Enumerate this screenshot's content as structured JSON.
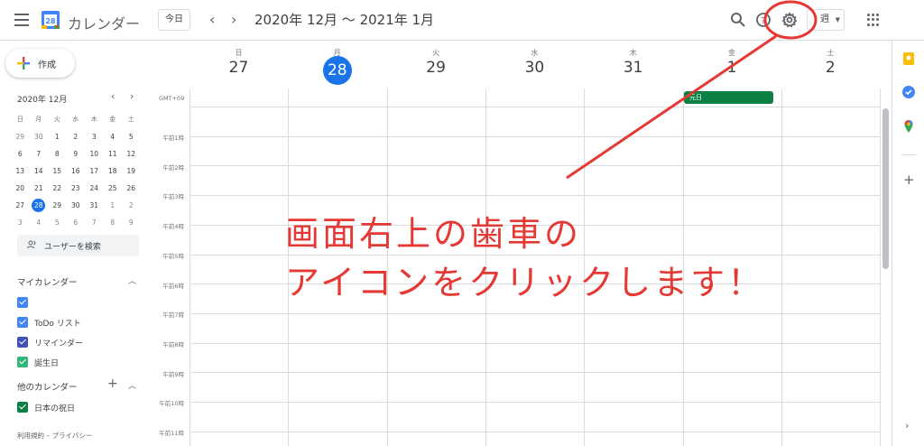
{
  "header": {
    "app_title": "カレンダー",
    "logo_day": "28",
    "today_label": "今日",
    "prev_icon": "chevron-left-icon",
    "next_icon": "chevron-right-icon",
    "range_title": "2020年 12月 ～ 2021年 1月",
    "view_label": "週",
    "brand_colors": {
      "blue": "#4285f4",
      "red": "#ea4335",
      "yellow": "#fbbc04",
      "green": "#34a853"
    }
  },
  "sidebar": {
    "create_label": "作成",
    "mini_calendar": {
      "title": "2020年 12月",
      "weekdays": [
        "日",
        "月",
        "火",
        "水",
        "木",
        "金",
        "土"
      ],
      "weeks": [
        [
          "29",
          "30",
          "1",
          "2",
          "3",
          "4",
          "5"
        ],
        [
          "6",
          "7",
          "8",
          "9",
          "10",
          "11",
          "12"
        ],
        [
          "13",
          "14",
          "15",
          "16",
          "17",
          "18",
          "19"
        ],
        [
          "20",
          "21",
          "22",
          "23",
          "24",
          "25",
          "26"
        ],
        [
          "27",
          "28",
          "29",
          "30",
          "31",
          "1",
          "2"
        ],
        [
          "3",
          "4",
          "5",
          "6",
          "7",
          "8",
          "9"
        ]
      ],
      "selected": "28"
    },
    "search_people_label": "ユーザーを検索",
    "my_calendars_title": "マイカレンダー",
    "my_calendars": [
      {
        "label": "",
        "color": "#4285f4"
      },
      {
        "label": "ToDo リスト",
        "color": "#4285f4"
      },
      {
        "label": "リマインダー",
        "color": "#3f51b5"
      },
      {
        "label": "誕生日",
        "color": "#33b679"
      }
    ],
    "other_calendars_title": "他のカレンダー",
    "other_calendars": [
      {
        "label": "日本の祝日",
        "color": "#0b8043"
      }
    ],
    "footer": "利用規約 – プライバシー"
  },
  "week": {
    "days": [
      {
        "name": "日",
        "num": "27",
        "today": false
      },
      {
        "name": "月",
        "num": "28",
        "today": true
      },
      {
        "name": "火",
        "num": "29",
        "today": false
      },
      {
        "name": "水",
        "num": "30",
        "today": false
      },
      {
        "name": "木",
        "num": "31",
        "today": false
      },
      {
        "name": "金",
        "num": "1",
        "today": false
      },
      {
        "name": "土",
        "num": "2",
        "today": false
      }
    ],
    "timezone": "GMT+09",
    "allday_event": {
      "label": "元日",
      "day": "金",
      "color": "#0b8043"
    },
    "hours": [
      "午前1時",
      "午前2時",
      "午前3時",
      "午前4時",
      "午前5時",
      "午前6時",
      "午前7時",
      "午前8時",
      "午前9時",
      "午前10時",
      "午前11時"
    ]
  },
  "side_panel": {
    "icons": [
      "keep-icon",
      "tasks-icon",
      "maps-icon"
    ]
  },
  "annotation": {
    "line1": "画面右上の歯車の",
    "line2": "アイコンをクリックします！",
    "color": "#e53935"
  }
}
